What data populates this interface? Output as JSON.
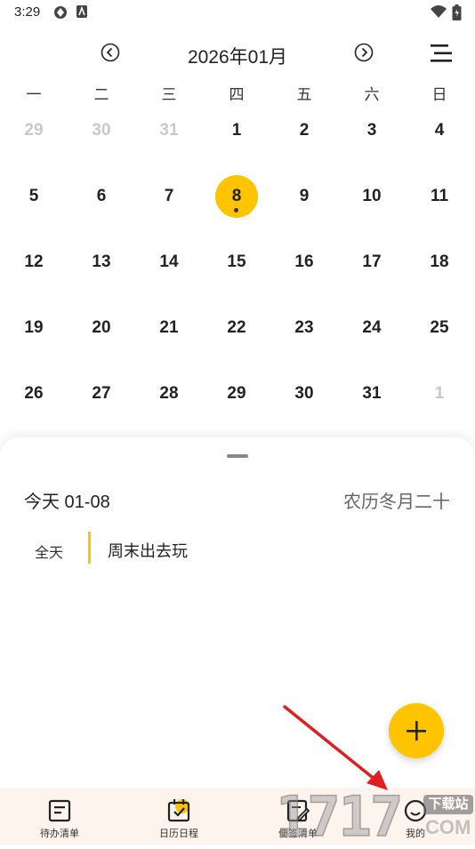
{
  "status": {
    "time": "3:29"
  },
  "header": {
    "month_title": "2026年01月"
  },
  "weekdays": [
    "一",
    "二",
    "三",
    "四",
    "五",
    "六",
    "日"
  ],
  "weeks": [
    [
      {
        "d": "29",
        "o": true
      },
      {
        "d": "30",
        "o": true
      },
      {
        "d": "31",
        "o": true
      },
      {
        "d": "1"
      },
      {
        "d": "2"
      },
      {
        "d": "3"
      },
      {
        "d": "4"
      }
    ],
    [
      {
        "d": "5"
      },
      {
        "d": "6"
      },
      {
        "d": "7"
      },
      {
        "d": "8",
        "today": true,
        "event": true
      },
      {
        "d": "9"
      },
      {
        "d": "10"
      },
      {
        "d": "11"
      }
    ],
    [
      {
        "d": "12"
      },
      {
        "d": "13"
      },
      {
        "d": "14"
      },
      {
        "d": "15"
      },
      {
        "d": "16"
      },
      {
        "d": "17"
      },
      {
        "d": "18"
      }
    ],
    [
      {
        "d": "19"
      },
      {
        "d": "20"
      },
      {
        "d": "21"
      },
      {
        "d": "22"
      },
      {
        "d": "23"
      },
      {
        "d": "24"
      },
      {
        "d": "25"
      }
    ],
    [
      {
        "d": "26"
      },
      {
        "d": "27"
      },
      {
        "d": "28"
      },
      {
        "d": "29"
      },
      {
        "d": "30"
      },
      {
        "d": "31"
      },
      {
        "d": "1",
        "o": true
      }
    ]
  ],
  "sheet": {
    "today_label": "今天 01-08",
    "lunar_label": "农历冬月二十",
    "event": {
      "time_label": "全天",
      "title": "周末出去玩"
    }
  },
  "tabs": [
    {
      "label": "待办清单",
      "icon": "todo-list-icon"
    },
    {
      "label": "日历日程",
      "icon": "calendar-check-icon"
    },
    {
      "label": "便签清单",
      "icon": "note-edit-icon"
    },
    {
      "label": "我的",
      "icon": "smiley-icon"
    }
  ],
  "watermark": {
    "text": "1717",
    "site": "下载站",
    "suffix": "COM"
  },
  "colors": {
    "accent": "#ffc400",
    "tabbar_bg": "#fdf4ee",
    "muted_day": "#c8c8c8",
    "arrow": "#e02020"
  }
}
